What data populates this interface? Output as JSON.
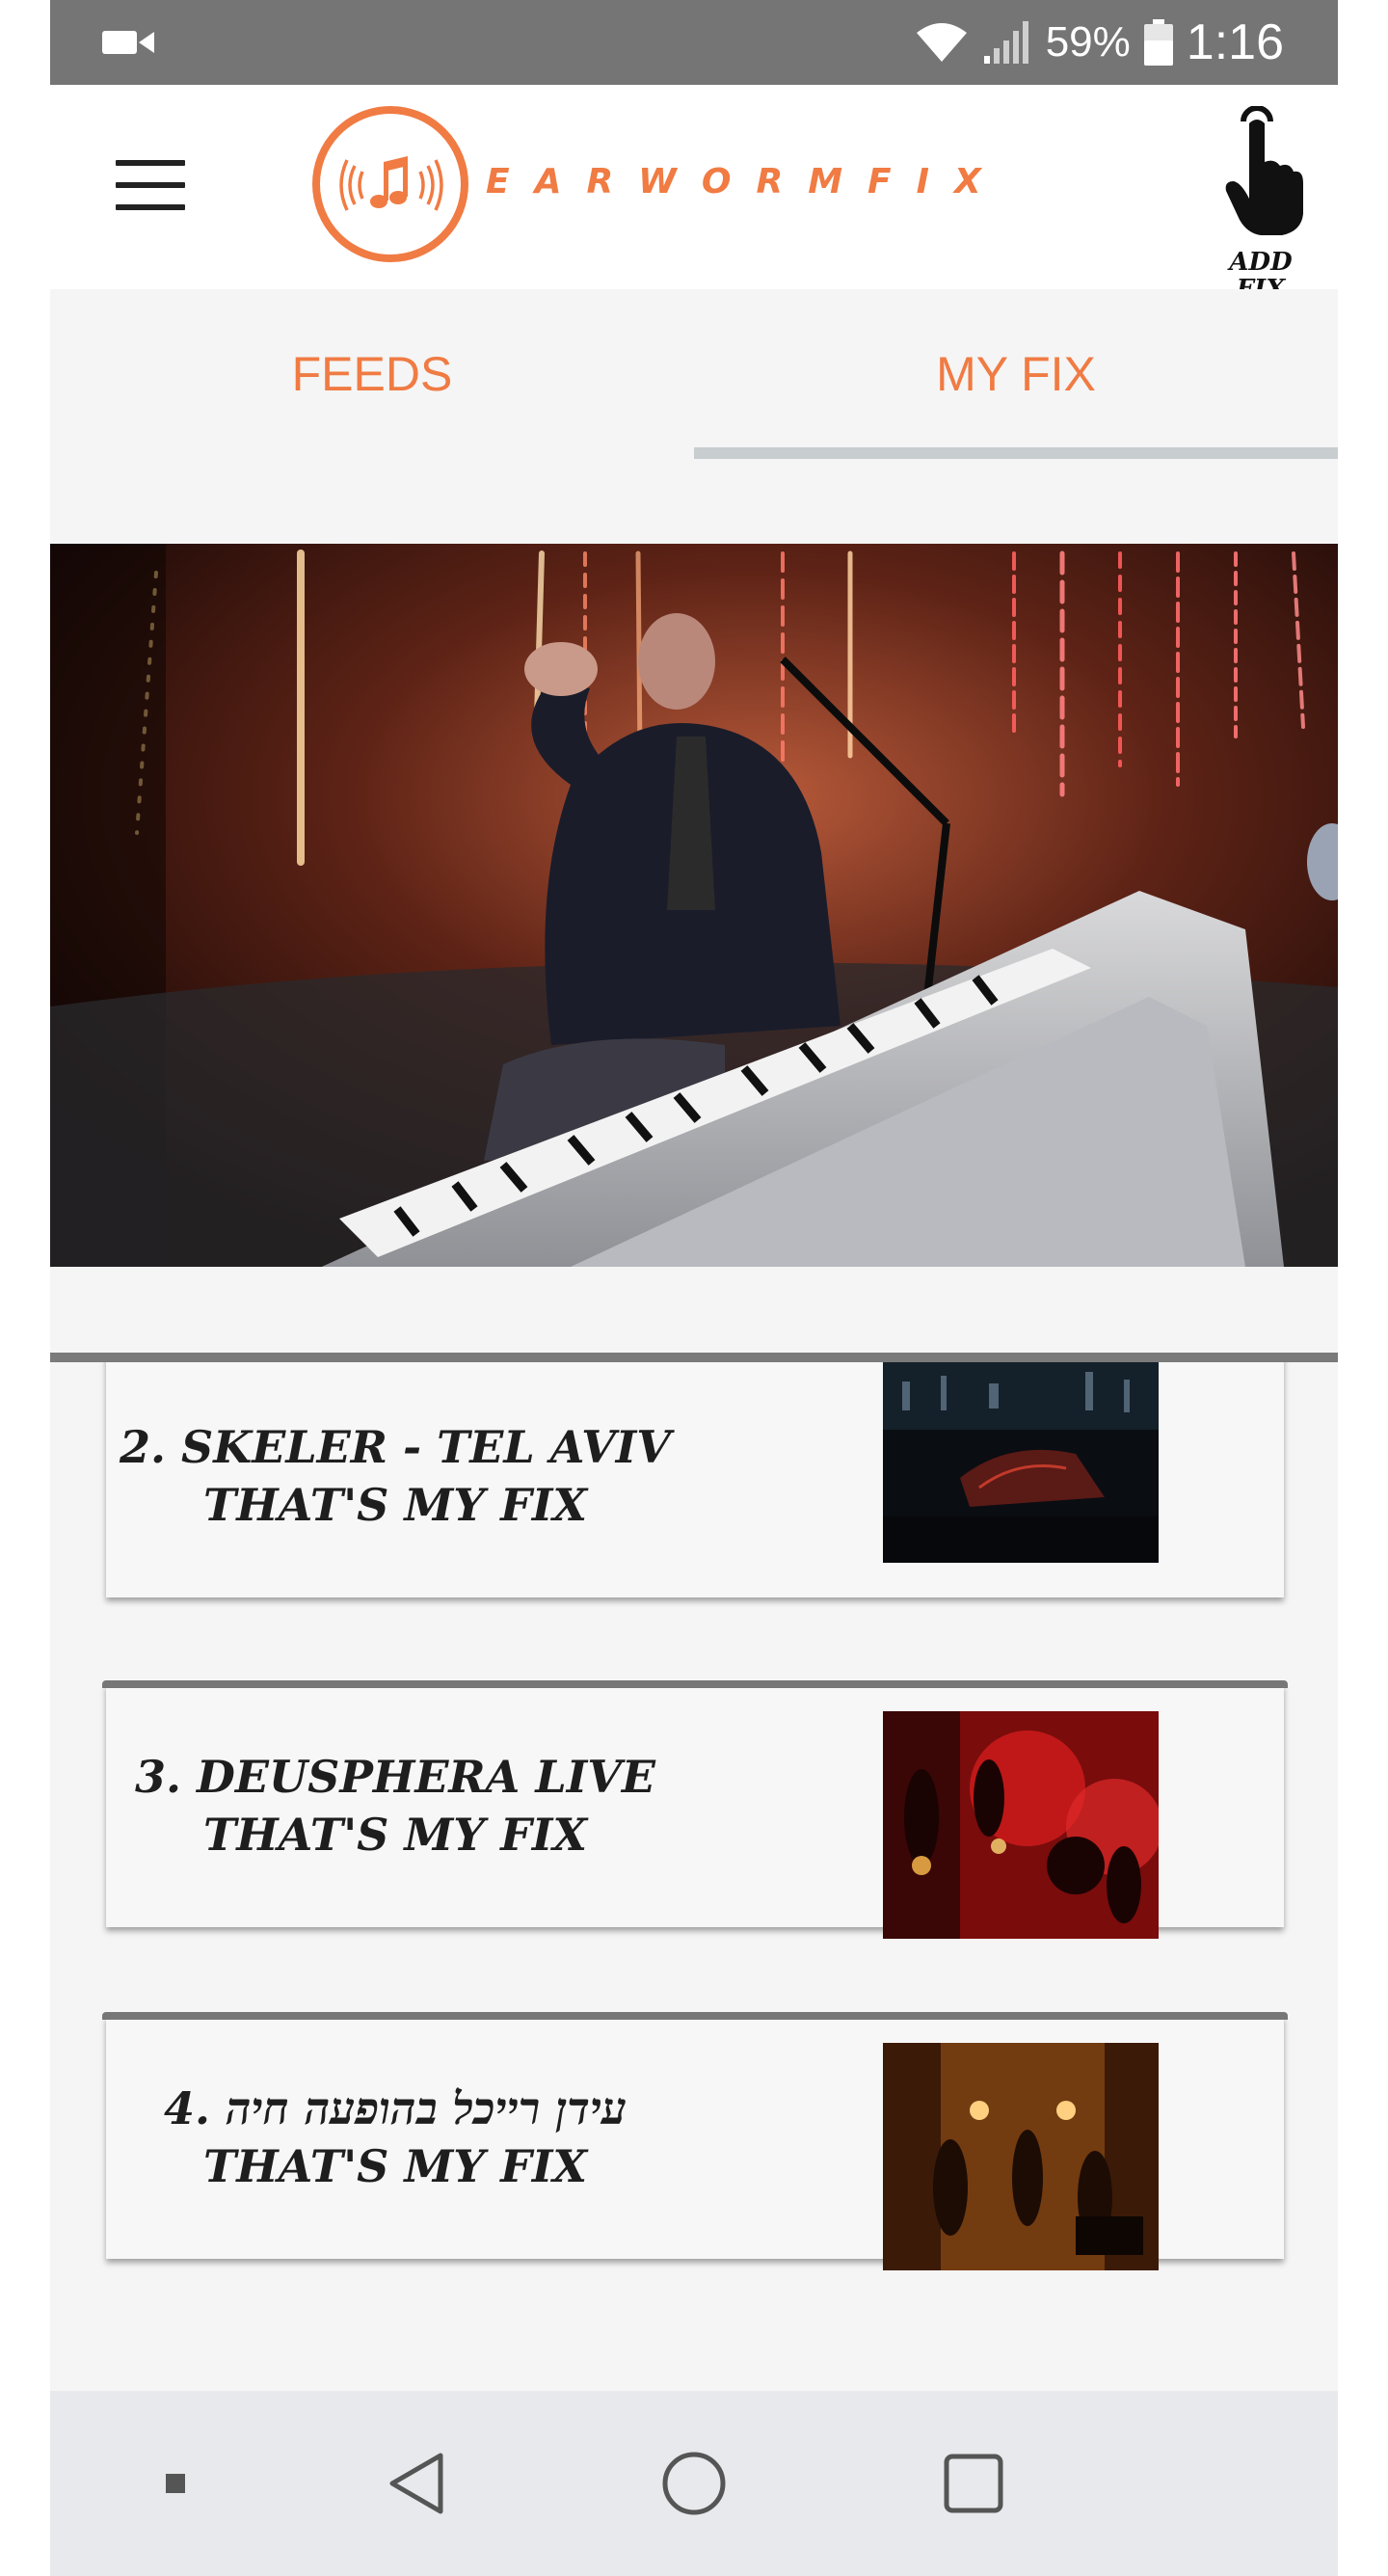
{
  "status_bar": {
    "camera_icon": "video-camera-icon",
    "battery_percent": "59%",
    "time": "1:16"
  },
  "header": {
    "menu_icon": "hamburger-menu-icon",
    "logo_text": "EARWORMFIX",
    "add_fix_line1": "ADD",
    "add_fix_line2": "FIX",
    "add_fix_icon": "tap-hand-icon"
  },
  "tabs": [
    {
      "label": "FEEDS",
      "active": false
    },
    {
      "label": "MY FIX",
      "active": true
    }
  ],
  "colors": {
    "accent": "#f07b43",
    "status_bar": "#757575",
    "tab_indicator": "#c8cdd0",
    "nav_bar": "#e8e9ec"
  },
  "playlist": [
    {
      "title": "2. SKELER - TEL AVIV",
      "subtitle": "THAT'S MY FIX"
    },
    {
      "title": "3. DEUSPHERA LIVE",
      "subtitle": "THAT'S MY FIX"
    },
    {
      "title": "4. עידן רייכל בהופעה חיה",
      "subtitle": "THAT'S MY FIX"
    }
  ],
  "nav_bar": {
    "square_icon": "small-square-icon",
    "back_icon": "back-triangle-icon",
    "home_icon": "home-circle-icon",
    "recents_icon": "recents-square-icon"
  }
}
